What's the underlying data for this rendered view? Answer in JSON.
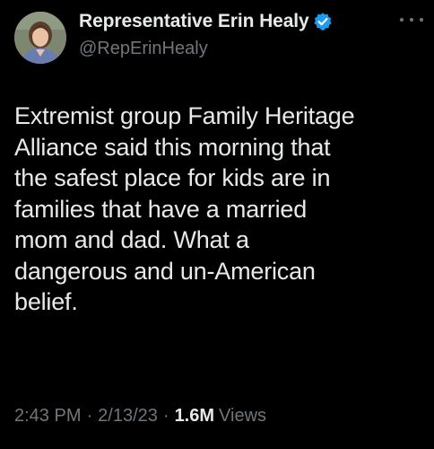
{
  "author": {
    "display_name": "Representative Erin Healy",
    "handle": "@RepErinHealy",
    "verified": true,
    "verified_color": "#1d9bf0"
  },
  "tweet": {
    "text": "Extremist group Family Heritage\nAlliance said this morning that\nthe safest place for kids are in\nfamilies that have a married\nmom and dad. What a\ndangerous and un-American\nbelief."
  },
  "meta": {
    "time": "2:43 PM",
    "separator": "·",
    "date": "2/13/23",
    "views_count": "1.6M",
    "views_label": "Views"
  },
  "icons": {
    "more": "more-horizontal-icon",
    "verified": "verified-badge-icon"
  },
  "colors": {
    "background": "#000000",
    "primary_text": "#e7e9ea",
    "secondary_text": "#71767b"
  }
}
